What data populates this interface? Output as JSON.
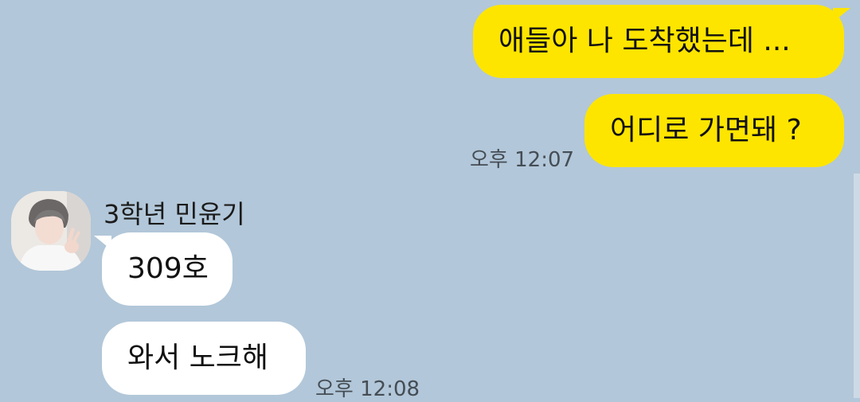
{
  "messages": {
    "sent": [
      {
        "text": "애들아 나 도착했는데 ..."
      },
      {
        "text": "어디로 가면돼 ?"
      }
    ],
    "sent_time": "오후 12:07",
    "received": {
      "sender": "3학년 민윤기",
      "avatar_icon": "profile-photo",
      "items": [
        {
          "text": "309호"
        },
        {
          "text": "와서 노크해"
        }
      ],
      "time": "오후 12:08"
    }
  },
  "colors": {
    "background": "#b2c7d9",
    "my_bubble": "#fee500",
    "their_bubble": "#ffffff"
  }
}
